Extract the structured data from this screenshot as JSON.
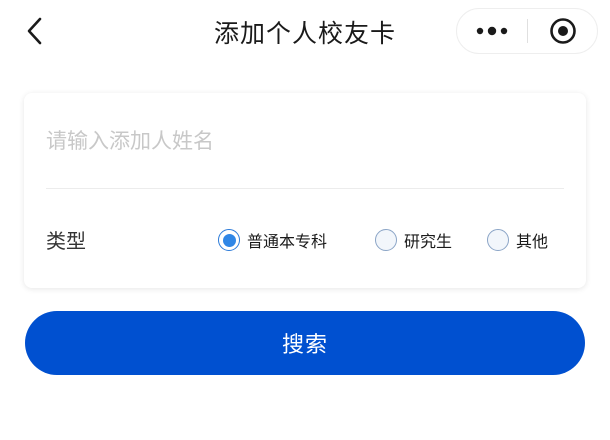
{
  "nav": {
    "title": "添加个人校友卡",
    "back_icon": "chevron-left-icon",
    "more_icon": "more-dots-icon",
    "close_icon": "target-close-icon"
  },
  "form": {
    "name_placeholder": "请输入添加人姓名",
    "name_value": "",
    "type_label": "类型",
    "type_options": [
      {
        "label": "普通本专科",
        "checked": true
      },
      {
        "label": "研究生",
        "checked": false
      },
      {
        "label": "其他",
        "checked": false
      }
    ]
  },
  "search_label": "搜索",
  "colors": {
    "primary_button": "#0050d0",
    "radio_checked": "#2f86e6",
    "placeholder": "#c8c8c8"
  }
}
